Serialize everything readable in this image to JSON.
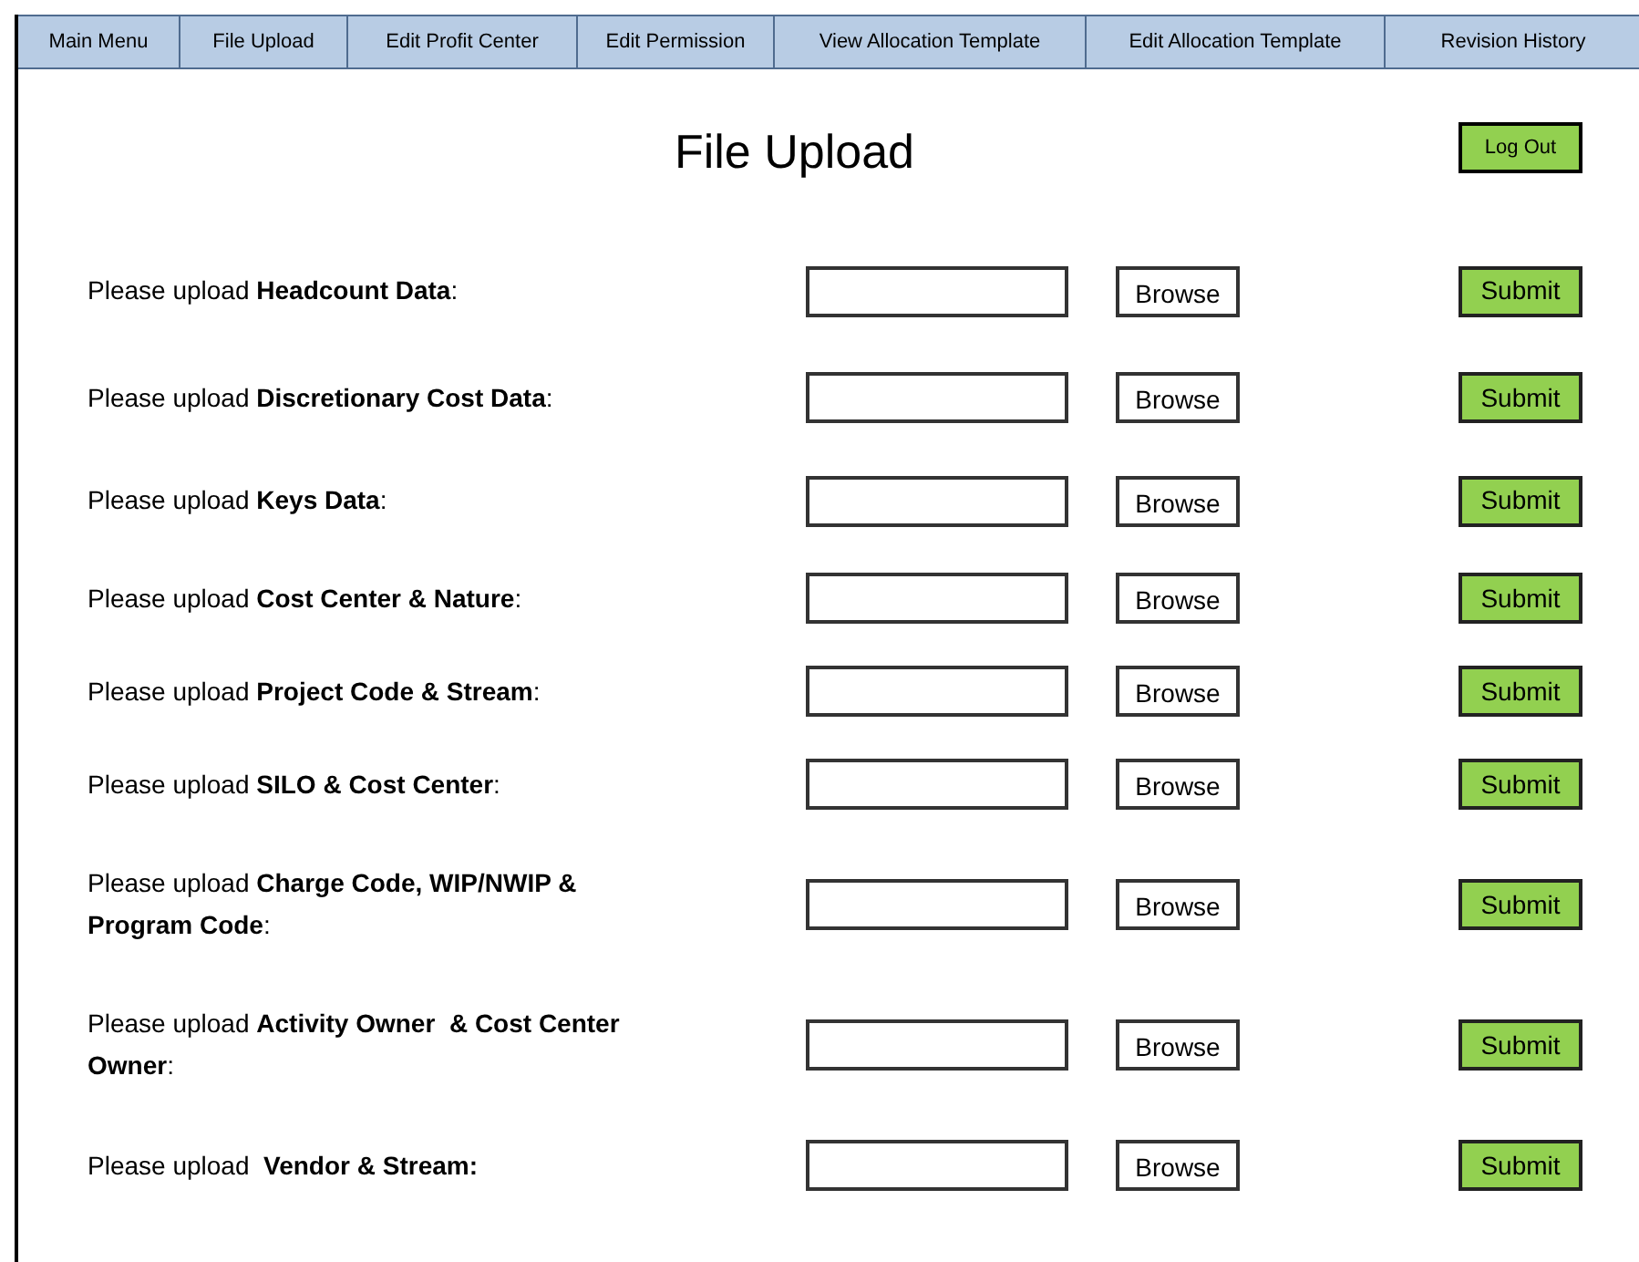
{
  "nav_tabs": [
    {
      "label": "Main Menu"
    },
    {
      "label": "File Upload"
    },
    {
      "label": "Edit Profit Center"
    },
    {
      "label": "Edit Permission"
    },
    {
      "label": "View Allocation Template"
    },
    {
      "label": "Edit Allocation Template"
    },
    {
      "label": "Revision History"
    }
  ],
  "title": "File Upload",
  "logout_button": "Log Out",
  "upload_rows": [
    {
      "label": "Please upload **Headcount Data**:",
      "browse": "Browse",
      "submit": "Submit"
    },
    {
      "label": "Please upload **Discretionary Cost Data**:",
      "browse": "Browse",
      "submit": "Submit"
    },
    {
      "label": "Please upload **Keys Data**:",
      "browse": "Browse",
      "submit": "Submit"
    },
    {
      "label": "Please upload **Cost Center & Nature**:",
      "browse": "Browse",
      "submit": "Submit"
    },
    {
      "label": "Please upload **Project Code & Stream**:",
      "browse": "Browse",
      "submit": "Submit"
    },
    {
      "label": "Please upload **SILO & Cost Center**:",
      "browse": "Browse",
      "submit": "Submit"
    },
    {
      "label": "Please upload **Charge Code, WIP/NWIP & Program Code**:",
      "browse": "Browse",
      "submit": "Submit"
    },
    {
      "label": "Please upload **Activity Owner  & Cost Center Owner**:",
      "browse": "Browse",
      "submit": "Submit"
    },
    {
      "label": "Please upload  **Vendor & Stream:**",
      "browse": "Browse",
      "submit": "Submit"
    }
  ]
}
